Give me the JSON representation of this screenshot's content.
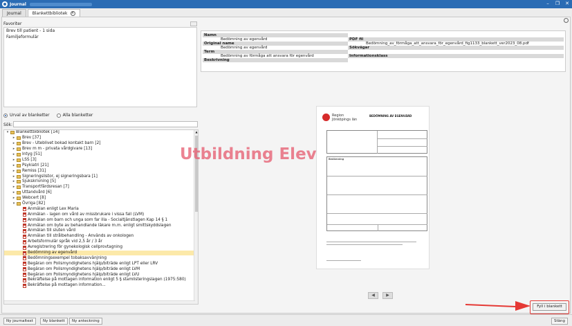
{
  "window": {
    "title": "Journal",
    "controls": [
      "–",
      "❐",
      "✕"
    ]
  },
  "tabs": [
    {
      "label": "Journal",
      "active": false
    },
    {
      "label": "Blankettbibliotek",
      "active": true
    }
  ],
  "favorites": {
    "label": "Favoriter",
    "items": [
      "Brev till patient - 1 sida",
      "Familjeformulär"
    ]
  },
  "filter": {
    "option_selected": "Urval av blanketter",
    "option_other": "Alla blanketter"
  },
  "search": {
    "label": "Sök:",
    "value": ""
  },
  "tree": [
    {
      "level": 0,
      "type": "folder",
      "arrow": "▾",
      "label": "Blankettbibliotek [14]"
    },
    {
      "level": 1,
      "type": "folder",
      "arrow": "▸",
      "label": "Brev [37]"
    },
    {
      "level": 1,
      "type": "folder",
      "arrow": "▸",
      "label": "Brev - Uteblivet bokad kontakt barn [2]"
    },
    {
      "level": 1,
      "type": "folder",
      "arrow": "▸",
      "label": "Brev m m - privata vårdgivare [13]"
    },
    {
      "level": 1,
      "type": "folder",
      "arrow": "▸",
      "label": "Intyg [51]"
    },
    {
      "level": 1,
      "type": "folder",
      "arrow": "▸",
      "label": "LSS [3]"
    },
    {
      "level": 1,
      "type": "folder",
      "arrow": "▸",
      "label": "Psykiatri [21]"
    },
    {
      "level": 1,
      "type": "folder",
      "arrow": "▸",
      "label": "Remiss [31]"
    },
    {
      "level": 1,
      "type": "folder",
      "arrow": "▸",
      "label": "Signeringslistor, ej signeringsbara [1]"
    },
    {
      "level": 1,
      "type": "folder",
      "arrow": "▸",
      "label": "Sjukskrivning [5]"
    },
    {
      "level": 1,
      "type": "folder",
      "arrow": "▸",
      "label": "Transportfärdsresan [7]"
    },
    {
      "level": 1,
      "type": "folder",
      "arrow": "▸",
      "label": "Uttandvård [6]"
    },
    {
      "level": 1,
      "type": "folder",
      "arrow": "▸",
      "label": "Webcert [8]"
    },
    {
      "level": 1,
      "type": "folder",
      "arrow": "▾",
      "label": "Övriga [82]"
    },
    {
      "level": 2,
      "type": "pdf",
      "label": "Anmälan enligt Lex Maria"
    },
    {
      "level": 2,
      "type": "pdf",
      "label": "Anmälan - lagen om vård av missbrukare i vissa fall (LVM)"
    },
    {
      "level": 2,
      "type": "pdf",
      "label": "Anmälan om barn och unga som far illa - Socialtjänstlagen Kap 14 § 1"
    },
    {
      "level": 2,
      "type": "pdf",
      "label": "Anmälan om byte av behandlande läkare m.m. enligt smittskyddslagen"
    },
    {
      "level": 2,
      "type": "pdf",
      "label": "Anmälan till sluten vård"
    },
    {
      "level": 2,
      "type": "pdf",
      "label": "Anmälan till strålbehandling - Används av onkologen"
    },
    {
      "level": 2,
      "type": "pdf",
      "label": "Arbetsformulär språk vid 2,5 år / 3 år"
    },
    {
      "level": 2,
      "type": "pdf",
      "label": "Avregistrering för gynekologisk cellprovtagning"
    },
    {
      "level": 2,
      "type": "pdf",
      "label": "Bedömning av egenvård",
      "selected": true
    },
    {
      "level": 2,
      "type": "pdf",
      "label": "Bedömningsexempel tobaksavvänjning"
    },
    {
      "level": 2,
      "type": "pdf",
      "label": "Begäran om Polismyndighetens hjälp/biträde enligt LPT eller LRV"
    },
    {
      "level": 2,
      "type": "pdf",
      "label": "Begäran om Polismyndighetens hjälp/biträde enligt LVM"
    },
    {
      "level": 2,
      "type": "pdf",
      "label": "Begäran om Polismyndighetens hjälp/biträde enligt LVU"
    },
    {
      "level": 2,
      "type": "pdf",
      "label": "Bekräftelse på mottagen information enligt 5 § stamlisteringslagen (1975:580)"
    },
    {
      "level": 2,
      "type": "pdf",
      "label": "Bekräftelse på mottagen information..."
    }
  ],
  "info": {
    "name_header": "Namn",
    "name_value": "Bedömning av egenvård",
    "original_header": "Original name",
    "original_value": "Bedömning av egenvård",
    "term_header": "Term",
    "term_value": "Bedömning av förmåga att ansvara för egenvård",
    "desc_header": "Beskrivning",
    "pdf_header": "PDF fil",
    "pdf_value": "Bedömning_av_förmåga_att_ansvara_för_egenvård_fig1133_blankett_ver2023_08.pdf",
    "keywords_header": "Sökvägar",
    "infoclass_header": "Informationsklass"
  },
  "preview": {
    "org_line1": "Region",
    "org_line2": "Jönköpings län",
    "form_title": "BEDÖMNING AV EGENVÅRD",
    "section": "Bedömning"
  },
  "watermark": "Utbildning Elev",
  "nav": {
    "prev": "◀",
    "next": "▶"
  },
  "actions": {
    "fill": "Fyll i blankett"
  },
  "bottom": {
    "new_journal": "Ny journaltext",
    "new_form": "Ny blankett",
    "new_note": "Ny anteckning",
    "close": "Stäng"
  },
  "colors": {
    "titlebar": "#2b6cb4",
    "selection": "#fce9a9",
    "watermark": "#e65a6e",
    "highlight": "#e53935"
  }
}
